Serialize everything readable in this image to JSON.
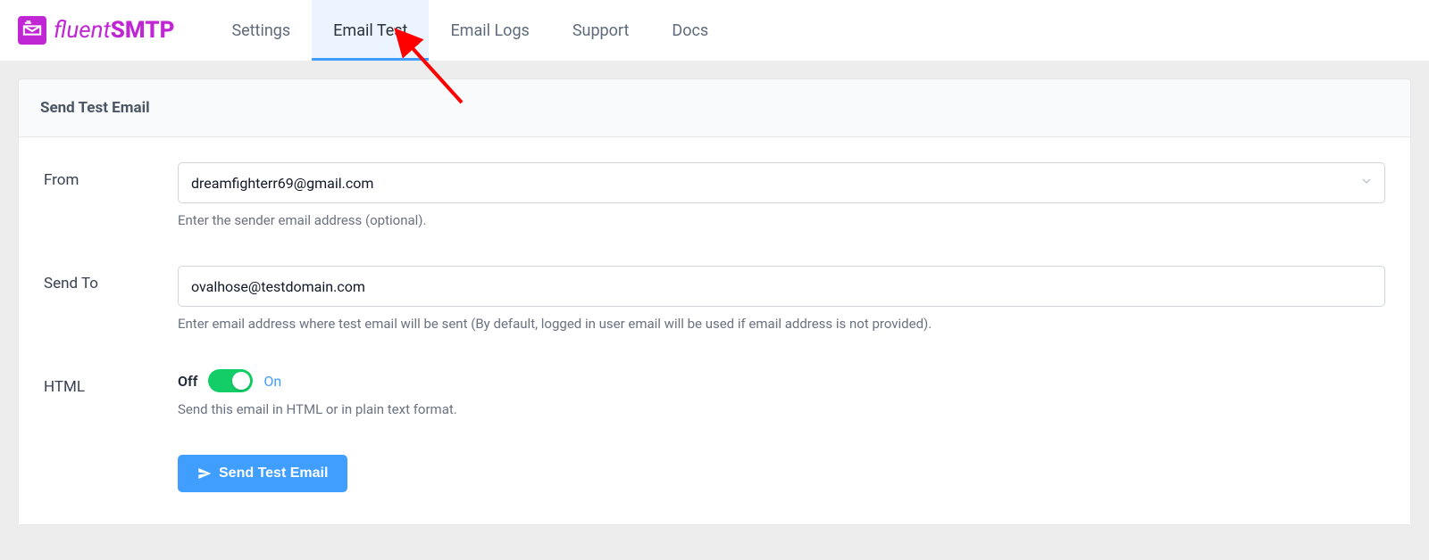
{
  "brand": {
    "name_light": "fluent",
    "name_bold": "SMTP"
  },
  "nav": {
    "items": [
      {
        "label": "Settings",
        "active": false
      },
      {
        "label": "Email Test",
        "active": true
      },
      {
        "label": "Email Logs",
        "active": false
      },
      {
        "label": "Support",
        "active": false
      },
      {
        "label": "Docs",
        "active": false
      }
    ]
  },
  "panel": {
    "title": "Send Test Email"
  },
  "form": {
    "from": {
      "label": "From",
      "value": "dreamfighterr69@gmail.com",
      "help": "Enter the sender email address (optional)."
    },
    "send_to": {
      "label": "Send To",
      "value": "ovalhose@testdomain.com",
      "help": "Enter email address where test email will be sent (By default, logged in user email will be used if email address is not provided)."
    },
    "html_toggle": {
      "label": "HTML",
      "off_text": "Off",
      "on_text": "On",
      "state": "on",
      "help": "Send this email in HTML or in plain text format."
    },
    "submit": {
      "label": "Send Test Email"
    }
  }
}
